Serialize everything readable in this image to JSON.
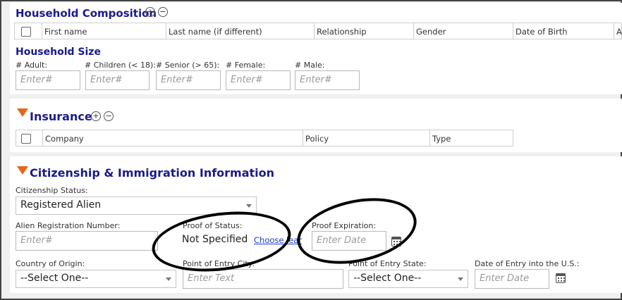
{
  "household_composition": {
    "title": "Household Composition",
    "columns": [
      "First name",
      "Last name (if different)",
      "Relationship",
      "Gender",
      "Date of Birth",
      "A"
    ]
  },
  "household_size": {
    "title": "Household Size",
    "fields": [
      {
        "label": "# Adult:",
        "placeholder": "Enter#"
      },
      {
        "label": "# Children (< 18):",
        "placeholder": "Enter#"
      },
      {
        "label": "# Senior (> 65):",
        "placeholder": "Enter#"
      },
      {
        "label": "# Female:",
        "placeholder": "Enter#"
      },
      {
        "label": "# Male:",
        "placeholder": "Enter#"
      }
    ]
  },
  "insurance": {
    "title": "Insurance",
    "columns": [
      "Company",
      "Policy",
      "Type"
    ]
  },
  "citizenship": {
    "title": "Citizenship & Immigration Information",
    "status_label": "Citizenship Status:",
    "status_value": "Registered Alien",
    "alien_reg_label": "Alien Registration Number:",
    "alien_reg_placeholder": "Enter#",
    "proof_label": "Proof of Status:",
    "proof_value": "Not Specified",
    "proof_choose": "Choose",
    "proof_clear": "lear",
    "expiration_label": "Proof Expiration:",
    "expiration_placeholder": "Enter Date",
    "country_label": "Country of Origin:",
    "country_value": "--Select One--",
    "entry_city_label": "Point of Entry City:",
    "entry_city_placeholder": "Enter Text",
    "entry_state_label": "Point of Entry State:",
    "entry_state_value": "--Select One--",
    "entry_date_label": "Date of Entry into the U.S.:",
    "entry_date_placeholder": "Enter Date"
  },
  "colors": {
    "heading": "#1a1a8c",
    "accent_triangle": "#e8651c",
    "link": "#1a3fd0"
  },
  "icons": [
    "add-icon",
    "remove-icon",
    "collapse-triangle-icon",
    "calendar-icon",
    "dropdown-caret-icon"
  ]
}
